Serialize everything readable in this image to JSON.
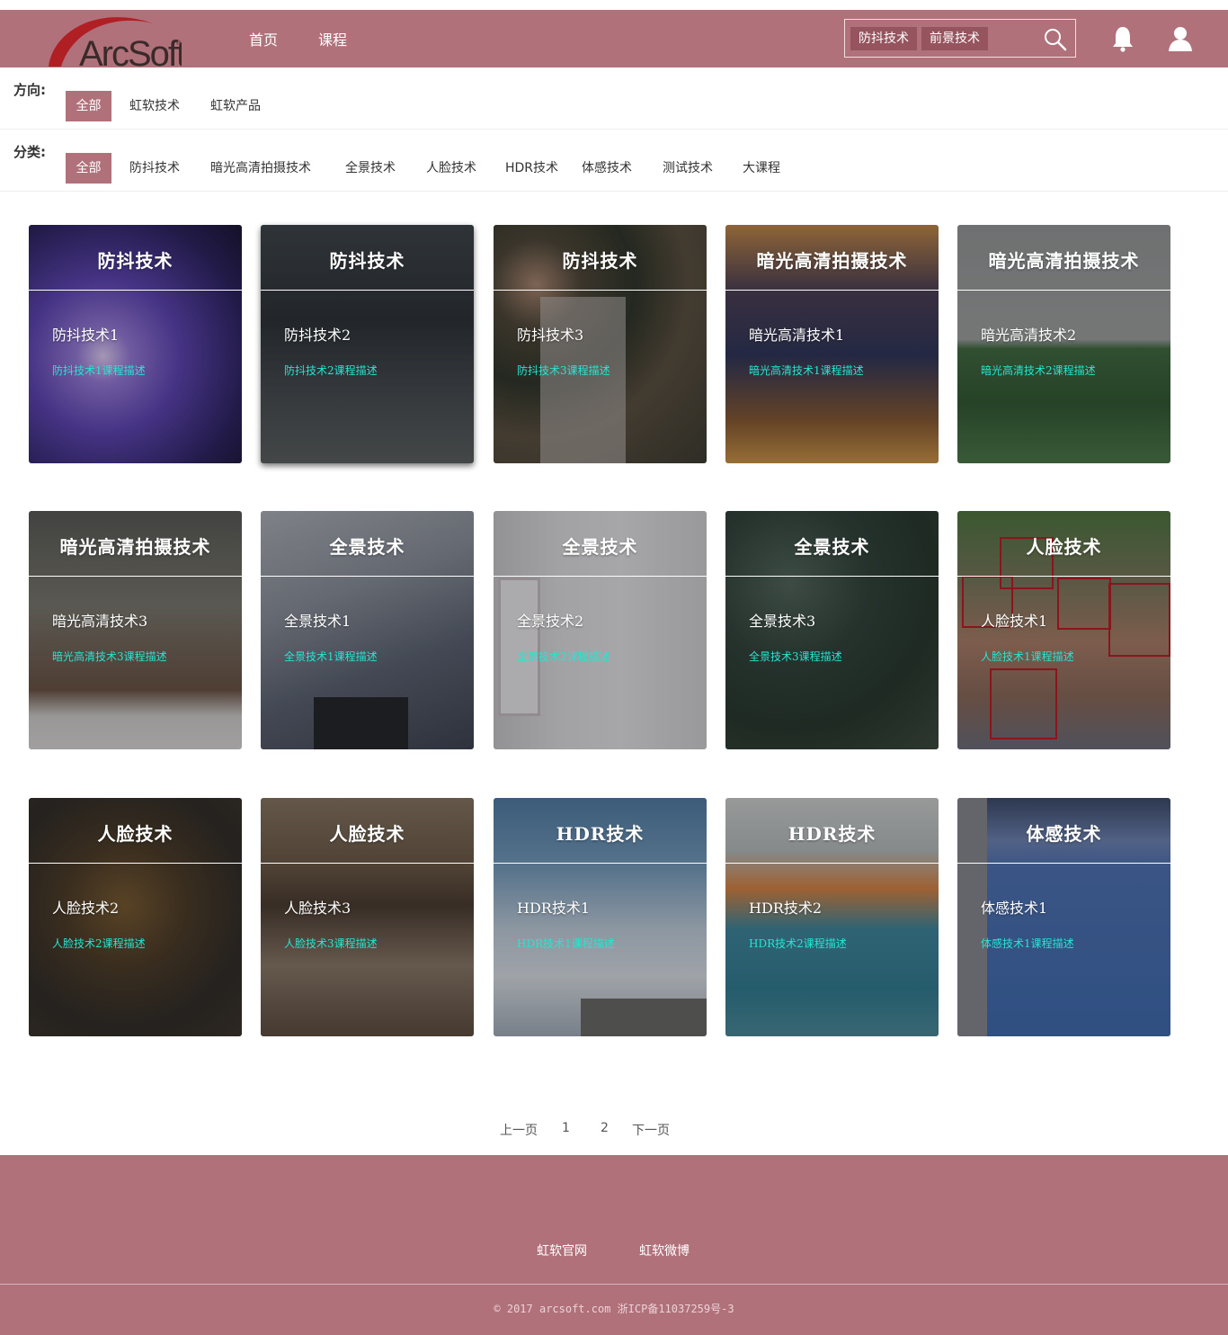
{
  "header": {
    "logo_text": "ArcSoft",
    "nav": [
      "首页",
      "课程"
    ],
    "search_tags": [
      "防抖技术",
      "前景技术"
    ],
    "icons": [
      "search-icon",
      "bell-icon",
      "user-icon"
    ]
  },
  "filters": {
    "direction": {
      "label": "方向:",
      "items": [
        "全部",
        "虹软技术",
        "虹软产品"
      ],
      "active": "全部"
    },
    "category": {
      "label": "分类:",
      "items": [
        "全部",
        "防抖技术",
        "暗光高清拍摄技术",
        "全景技术",
        "人脸技术",
        "HDR技术",
        "体感技术",
        "测试技术",
        "大课程"
      ],
      "active": "全部"
    }
  },
  "cards": [
    {
      "title": "防抖技术",
      "name": "防抖技术1",
      "desc": "防抖技术1课程描述"
    },
    {
      "title": "防抖技术",
      "name": "防抖技术2",
      "desc": "防抖技术2课程描述"
    },
    {
      "title": "防抖技术",
      "name": "防抖技术3",
      "desc": "防抖技术3课程描述"
    },
    {
      "title": "暗光高清拍摄技术",
      "name": "暗光高清技术1",
      "desc": "暗光高清技术1课程描述"
    },
    {
      "title": "暗光高清拍摄技术",
      "name": "暗光高清技术2",
      "desc": "暗光高清技术2课程描述"
    },
    {
      "title": "暗光高清拍摄技术",
      "name": "暗光高清技术3",
      "desc": "暗光高清技术3课程描述"
    },
    {
      "title": "全景技术",
      "name": "全景技术1",
      "desc": "全景技术1课程描述"
    },
    {
      "title": "全景技术",
      "name": "全景技术2",
      "desc": "全景技术2课程描述"
    },
    {
      "title": "全景技术",
      "name": "全景技术3",
      "desc": "全景技术3课程描述"
    },
    {
      "title": "人脸技术",
      "name": "人脸技术1",
      "desc": "人脸技术1课程描述"
    },
    {
      "title": "人脸技术",
      "name": "人脸技术2",
      "desc": "人脸技术2课程描述"
    },
    {
      "title": "人脸技术",
      "name": "人脸技术3",
      "desc": "人脸技术3课程描述"
    },
    {
      "title": "HDR技术",
      "name": "HDR技术1",
      "desc": "HDR技术1课程描述"
    },
    {
      "title": "HDR技术",
      "name": "HDR技术2",
      "desc": "HDR技术2课程描述"
    },
    {
      "title": "体感技术",
      "name": "体感技术1",
      "desc": "体感技术1课程描述"
    }
  ],
  "pagination": {
    "prev": "上一页",
    "pages": [
      "1",
      "2"
    ],
    "next": "下一页"
  },
  "footer": {
    "links": [
      "虹软官网",
      "虹软微博"
    ],
    "copyright": "© 2017 arcsoft.com  浙ICP备11037259号-3"
  },
  "colors": {
    "brand": "#b0717b",
    "tag": "#96545f",
    "desc": "#24e6d2"
  }
}
